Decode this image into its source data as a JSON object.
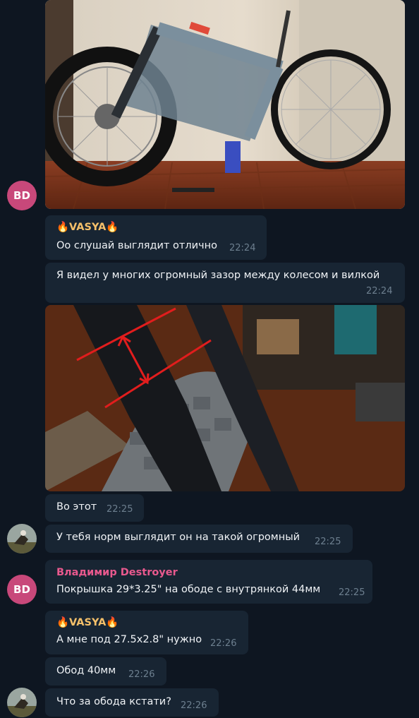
{
  "messages": [
    {
      "type": "photo",
      "description": "bike photo"
    },
    {
      "sender": "🔥VASYA🔥",
      "text": "Оо слушай выглядит отлично",
      "time": "22:24"
    },
    {
      "text": "Я видел у многих огромный зазор между колесом и вилкой",
      "time": "22:24"
    },
    {
      "type": "photo",
      "description": "fork gap photo"
    },
    {
      "text": "Во этот",
      "time": "22:25"
    },
    {
      "text": "У тебя норм выглядит он на такой огромный",
      "time": "22:25"
    },
    {
      "sender": "Владимир Destroyer",
      "text": "Покрышка 29*3.25\" на ободе с внутрянкой 44мм",
      "time": "22:25"
    },
    {
      "sender": "🔥VASYA🔥",
      "text": "А мне под 27.5x2.8\" нужно",
      "time": "22:26"
    },
    {
      "text": "Обод 40мм",
      "time": "22:26"
    },
    {
      "text": "Что за обода кстати?",
      "time": "22:26"
    }
  ],
  "avatars": {
    "bd_initials": "BD"
  },
  "colors": {
    "background": "#0e1621",
    "bubble": "#182533",
    "vasya_name": "#f5c06a",
    "vladimir_name": "#e9598e",
    "avatar_bd": "#c8487a"
  }
}
